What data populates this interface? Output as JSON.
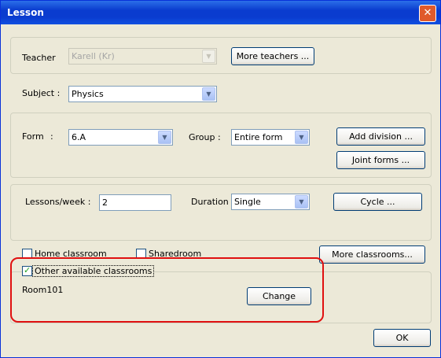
{
  "window": {
    "title": "Lesson",
    "close_glyph": "✕"
  },
  "teacher": {
    "label": "Teacher",
    "value": "Karell (Kr)",
    "more_button": "More teachers ..."
  },
  "subject": {
    "label": "Subject :",
    "value": "Physics"
  },
  "form": {
    "label": "Form",
    "colon": ":",
    "value": "6.A",
    "group_label": "Group :",
    "group_value": "Entire form",
    "add_division": "Add division ...",
    "joint_forms": "Joint forms ..."
  },
  "lessons": {
    "label": "Lessons/week :",
    "value": "2",
    "duration_label": "Duration",
    "duration_value": "Single",
    "cycle_button": "Cycle ..."
  },
  "classrooms": {
    "home_label": "Home classroom",
    "shared_label": "Sharedroom",
    "more_button": "More classrooms...",
    "other_label": "Other available classrooms",
    "other_checked": true,
    "room": "Room101",
    "change_button": "Change"
  },
  "footer": {
    "ok_button": "OK"
  },
  "icons": {
    "dropdown": "chevron-down-icon",
    "check": "checkmark-icon",
    "close": "close-icon"
  },
  "colors": {
    "titlebar": "#0a3ccf",
    "face": "#ece9d8",
    "highlight": "#e01010",
    "check": "#21a121"
  }
}
